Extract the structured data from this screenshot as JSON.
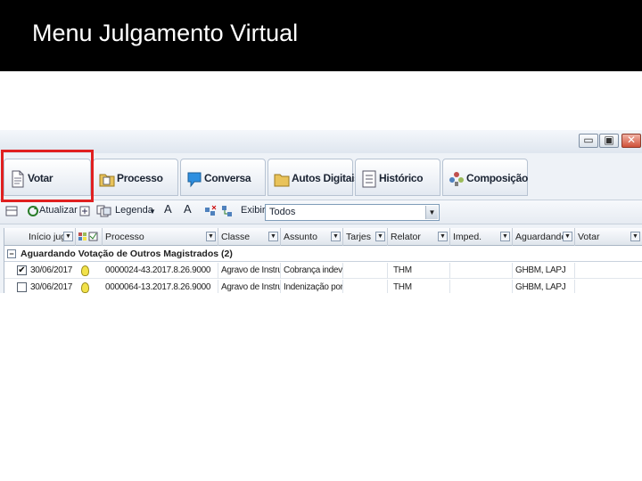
{
  "slide": {
    "title": "Menu Julgamento Virtual"
  },
  "window_controls": {
    "minimize": "▭",
    "maximize": "▣",
    "close": "✕"
  },
  "tabs": [
    {
      "label": "Votar",
      "icon": "document-icon"
    },
    {
      "label": "Processo",
      "icon": "folder-icon"
    },
    {
      "label": "Conversa",
      "icon": "chat-bubble-icon"
    },
    {
      "label": "Autos Digitais",
      "icon": "folder-icon"
    },
    {
      "label": "Histórico",
      "icon": "list-icon"
    },
    {
      "label": "Composição",
      "icon": "people-icon"
    }
  ],
  "toolbar": {
    "refresh_label": "Atualizar",
    "legend_label": "Legenda",
    "font_increase": "A",
    "font_decrease": "A",
    "show_label": "Exibir:",
    "filter_value": "Todos"
  },
  "grid": {
    "columns": [
      "Início jug.",
      "",
      "Processo",
      "Classe",
      "Assunto",
      "Tarjes",
      "Relator",
      "Imped.",
      "Aguardando",
      "Votar"
    ],
    "group_label": "Aguardando Votação de Outros Magistrados (2)",
    "group_toggle": "−",
    "rows": [
      {
        "checked": true,
        "check_mark": "✔",
        "date": "30/06/2017",
        "processo": "0000024-43.2017.8.26.9000",
        "classe": "Agravo de Instrume",
        "assunto": "Cobrança indevida",
        "tarjas": "",
        "relator": "THM",
        "imped": "",
        "aguardando": "GHBM, LAPJ",
        "votar": ""
      },
      {
        "checked": false,
        "check_mark": "",
        "date": "30/06/2017",
        "processo": "0000064-13.2017.8.26.9000",
        "classe": "Agravo de Instrume",
        "assunto": "Indenização por Da",
        "tarjas": "",
        "relator": "THM",
        "imped": "",
        "aguardando": "GHBM, LAPJ",
        "votar": ""
      }
    ]
  },
  "colors": {
    "highlight": "#e02020",
    "title_bar": "#000000"
  }
}
